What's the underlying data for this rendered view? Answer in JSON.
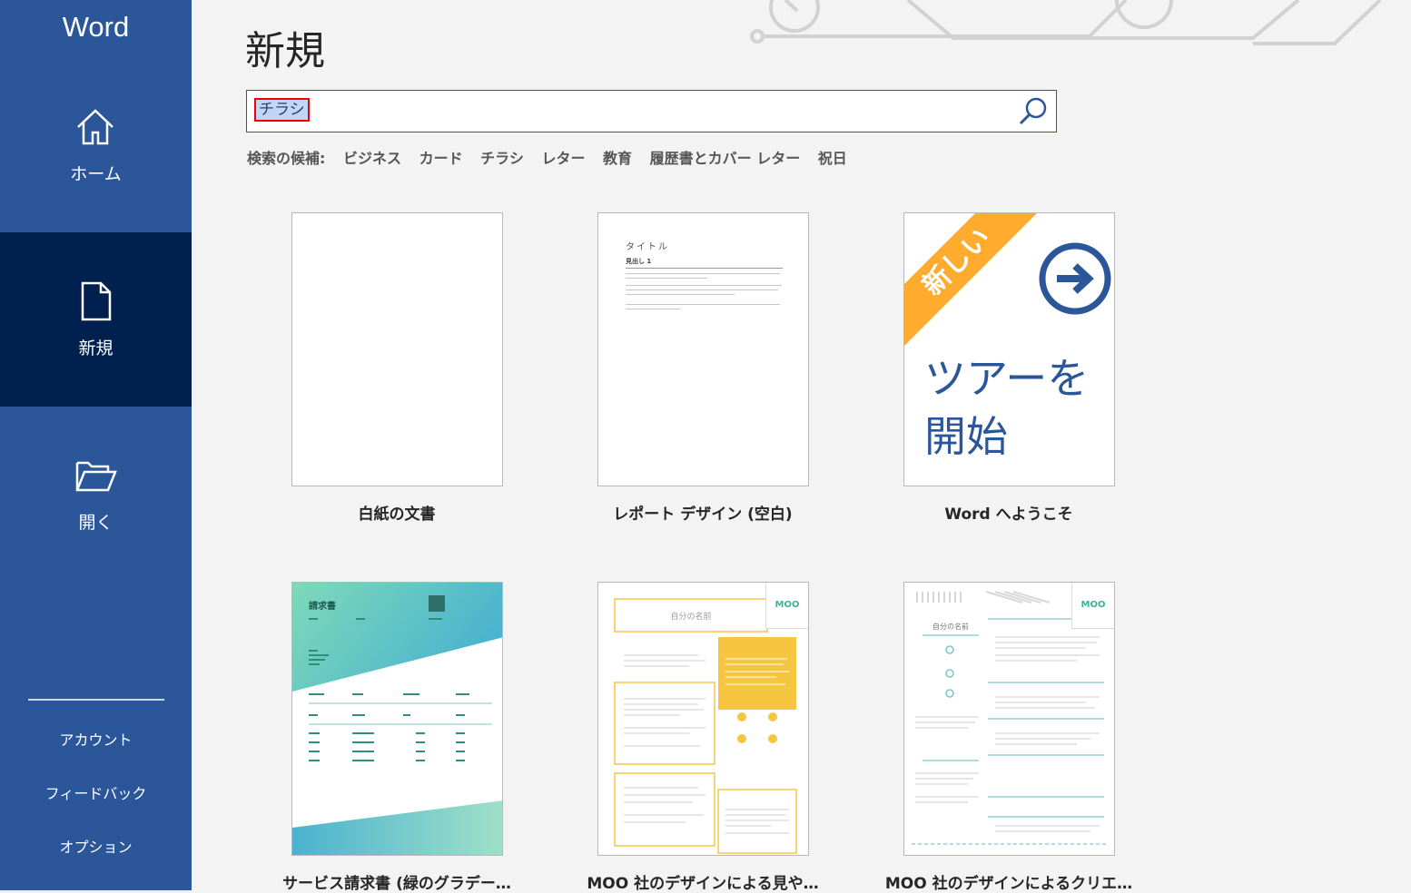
{
  "app": {
    "name": "Word"
  },
  "sidebar": {
    "items": [
      {
        "label": "ホーム",
        "icon": "home-icon",
        "active": false
      },
      {
        "label": "新規",
        "icon": "new-document-icon",
        "active": true
      },
      {
        "label": "開く",
        "icon": "open-folder-icon",
        "active": false
      }
    ],
    "bottom_links": [
      {
        "label": "アカウント"
      },
      {
        "label": "フィードバック"
      },
      {
        "label": "オプション"
      }
    ]
  },
  "main": {
    "title": "新規",
    "search": {
      "value": "チラシ",
      "button_icon": "search-icon"
    },
    "suggestions": {
      "label": "検索の候補:",
      "items": [
        "ビジネス",
        "カード",
        "チラシ",
        "レター",
        "教育",
        "履歴書とカバー レター",
        "祝日"
      ]
    },
    "templates": [
      {
        "caption": "白紙の文書"
      },
      {
        "caption": "レポート デザイン (空白)",
        "preview": {
          "title": "タイトル",
          "heading": "見出し 1"
        }
      },
      {
        "caption": "Word へようこそ",
        "preview": {
          "badge": "新しい",
          "text_line1": "ツアーを",
          "text_line2": "開始"
        }
      },
      {
        "caption": "サービス請求書 (緑のグラデー…",
        "preview": {
          "title": "請求書"
        }
      },
      {
        "caption": "MOO 社のデザインによる見や…",
        "preview": {
          "name": "自分の名前",
          "brand": "MOO"
        }
      },
      {
        "caption": "MOO 社のデザインによるクリエ…",
        "preview": {
          "name": "自分の名前",
          "brand": "MOO"
        }
      }
    ]
  },
  "colors": {
    "sidebar": "#2b579a",
    "sidebar_active": "#002050",
    "ribbon": "#ffab2e",
    "moo_accent": "#3cb29e"
  }
}
